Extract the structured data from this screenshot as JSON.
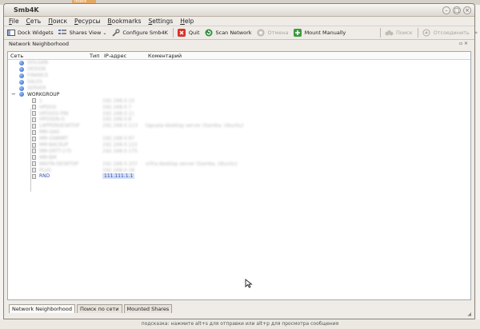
{
  "background": {
    "top_tab": "поиск",
    "status_text": "подсказка: нажмите alt+s для отправки или alt+p для просмотра сообщения"
  },
  "window": {
    "title": "Smb4K"
  },
  "menu": [
    {
      "pre": "",
      "u": "F",
      "post": "ile"
    },
    {
      "pre": "",
      "u": "С",
      "post": "еть"
    },
    {
      "pre": "",
      "u": "П",
      "post": "оиск"
    },
    {
      "pre": "",
      "u": "Р",
      "post": "есурсы"
    },
    {
      "pre": "",
      "u": "B",
      "post": "ookmarks"
    },
    {
      "pre": "",
      "u": "S",
      "post": "ettings"
    },
    {
      "pre": "",
      "u": "H",
      "post": "elp"
    }
  ],
  "toolbar": {
    "dock": "Dock Widgets",
    "shares_view": "Shares View",
    "configure": "Configure Smb4K",
    "quit": "Quit",
    "scan": "Scan Network",
    "cancel": "Отмена",
    "mount": "Mount Manually",
    "search": "Поиск",
    "unmount": "Отсоединить"
  },
  "dock": {
    "title": "Network Neighborhood",
    "controls": "▫ ×"
  },
  "table": {
    "headers": {
      "network": "Сеть",
      "type": "Тип",
      "ip": "IP-адрес",
      "comment": "Коментарий"
    },
    "workgroups_blurred": [
      "DOLGAN",
      "DESIGN",
      "FINANCE",
      "SALES",
      "SERVER"
    ],
    "workgroup": "WORKGROUP",
    "hosts_blurred": [
      {
        "name": "1",
        "ip": "192.168.0.10",
        "comment": ""
      },
      {
        "name": "HPDOS",
        "ip": "192.168.0.7",
        "comment": ""
      },
      {
        "name": "HPOSSS-PIN",
        "ip": "192.168.0.11",
        "comment": ""
      },
      {
        "name": "HPOSSN-G",
        "ip": "192.168.0.8",
        "comment": ""
      },
      {
        "name": "LAPPERDESKTOP",
        "ip": "192.168.0.113",
        "comment": "tapusia-desktop server (Samba, Ubuntu)"
      },
      {
        "name": "MM-GAS",
        "ip": "",
        "comment": ""
      },
      {
        "name": "MM-SSBNRT",
        "ip": "192.168.0.97",
        "comment": ""
      },
      {
        "name": "MM-BACKUP",
        "ip": "192.168.0.122",
        "comment": ""
      },
      {
        "name": "MM-ERTT-175",
        "ip": "192.168.0.175",
        "comment": ""
      },
      {
        "name": "MM-BM",
        "ip": "",
        "comment": ""
      },
      {
        "name": "NIKITA-DESKTOP",
        "ip": "192.168.0.107",
        "comment": "niTra-desktop server (Samba, Ubuntu)"
      },
      {
        "name": "PLUS",
        "ip": "192.168.0.18",
        "comment": ""
      }
    ],
    "selected_host": {
      "name": "RND",
      "ip": "111.111.1.1"
    }
  },
  "tabs": [
    "Network Neighborhood",
    "Поиск по сети",
    "Mounted Shares"
  ]
}
